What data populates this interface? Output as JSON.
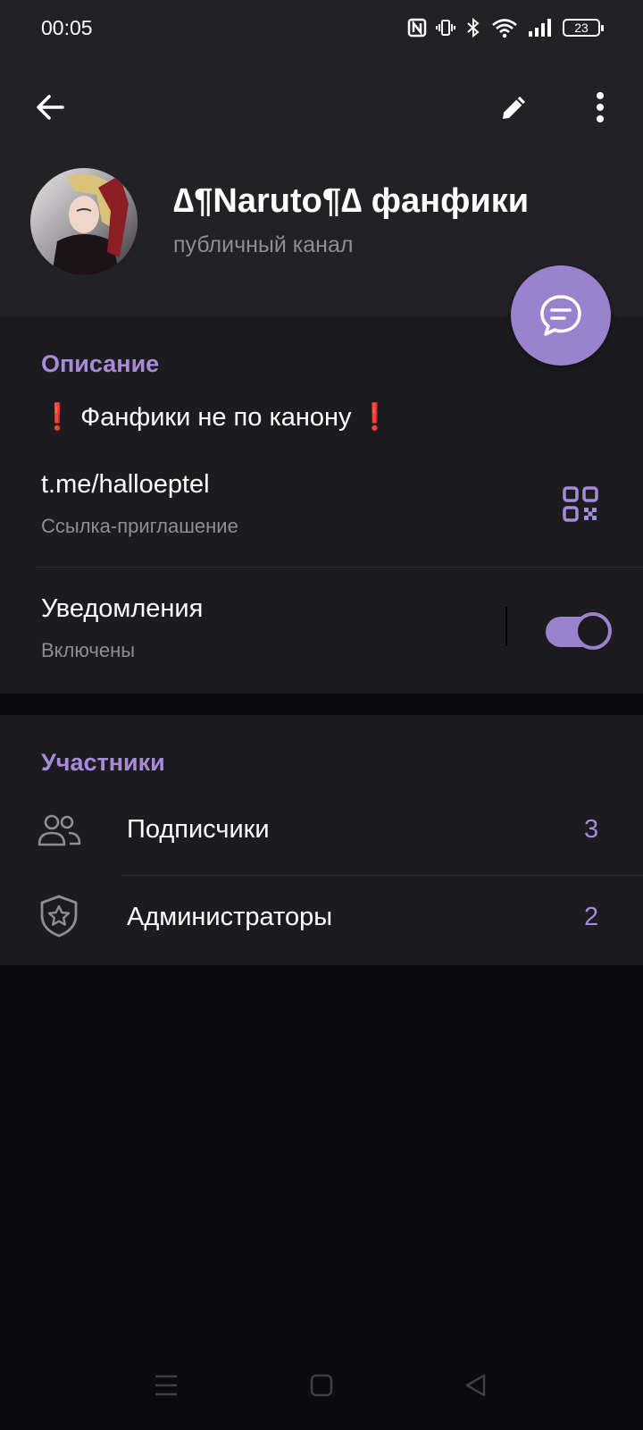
{
  "status_bar": {
    "time": "00:05",
    "battery": "23",
    "icons": [
      "nfc-icon",
      "vibrate-icon",
      "bluetooth-icon",
      "wifi-icon",
      "signal-icon",
      "battery-icon"
    ]
  },
  "header": {
    "title": "∆¶Naruto¶∆ фанфики",
    "subtitle": "публичный канал",
    "icons": [
      "back-arrow-icon",
      "edit-pencil-icon",
      "more-vertical-icon"
    ]
  },
  "fab": {
    "icon": "chat-bubble-icon"
  },
  "info": {
    "section_title": "Описание",
    "description": "❗ Фанфики не по канону ❗",
    "link": "t.me/halloeptel",
    "link_caption": "Ссылка-приглашение",
    "qr_icon": "qr-code-icon",
    "notifications_label": "Уведомления",
    "notifications_status": "Включены",
    "notifications_enabled": true
  },
  "members": {
    "section_title": "Участники",
    "rows": [
      {
        "icon": "people-icon",
        "label": "Подписчики",
        "count": "3"
      },
      {
        "icon": "shield-star-icon",
        "label": "Администраторы",
        "count": "2"
      }
    ]
  },
  "nav_bar": {
    "icons": [
      "menu-lines-icon",
      "home-square-icon",
      "back-triangle-icon"
    ]
  },
  "colors": {
    "accent": "#9a82cf",
    "accent_text": "#a78bdb",
    "header_bg": "#222125",
    "card_bg": "#1c1b1f",
    "page_bg": "#0b0a0d",
    "secondary_text": "#8e8d93"
  }
}
